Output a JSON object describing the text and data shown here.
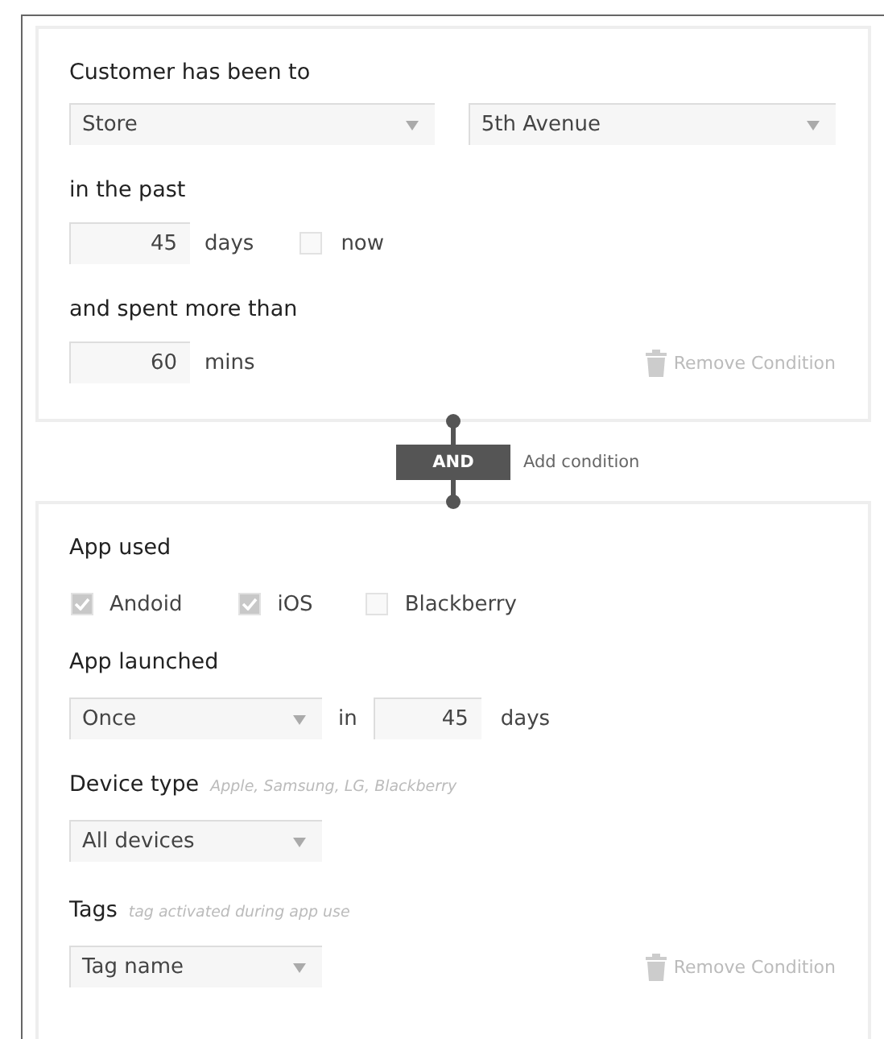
{
  "visit_condition": {
    "title": "Customer has been to",
    "place_type": "Store",
    "place": "5th Avenue",
    "past_label": "in the past",
    "past_value": "45",
    "past_unit": "days",
    "now": {
      "label": "now",
      "checked": false
    },
    "spent_label": "and spent more than",
    "spent_value": "60",
    "spent_unit": "mins",
    "remove": "Remove Condition"
  },
  "connector": {
    "operator": "AND",
    "add": "Add condition"
  },
  "app_condition": {
    "app_used_label": "App used",
    "platforms": [
      {
        "label": "Andoid",
        "checked": true
      },
      {
        "label": "iOS",
        "checked": true
      },
      {
        "label": "Blackberry",
        "checked": false
      }
    ],
    "launched_label": "App launched",
    "frequency": "Once",
    "in_label": "in",
    "launched_value": "45",
    "launched_unit": "days",
    "device_label": "Device type",
    "device_hint": "Apple, Samsung, LG, Blackberry",
    "device": "All devices",
    "tags_label": "Tags",
    "tags_hint": "tag activated during app use",
    "tag": "Tag name",
    "remove": "Remove Condition"
  }
}
